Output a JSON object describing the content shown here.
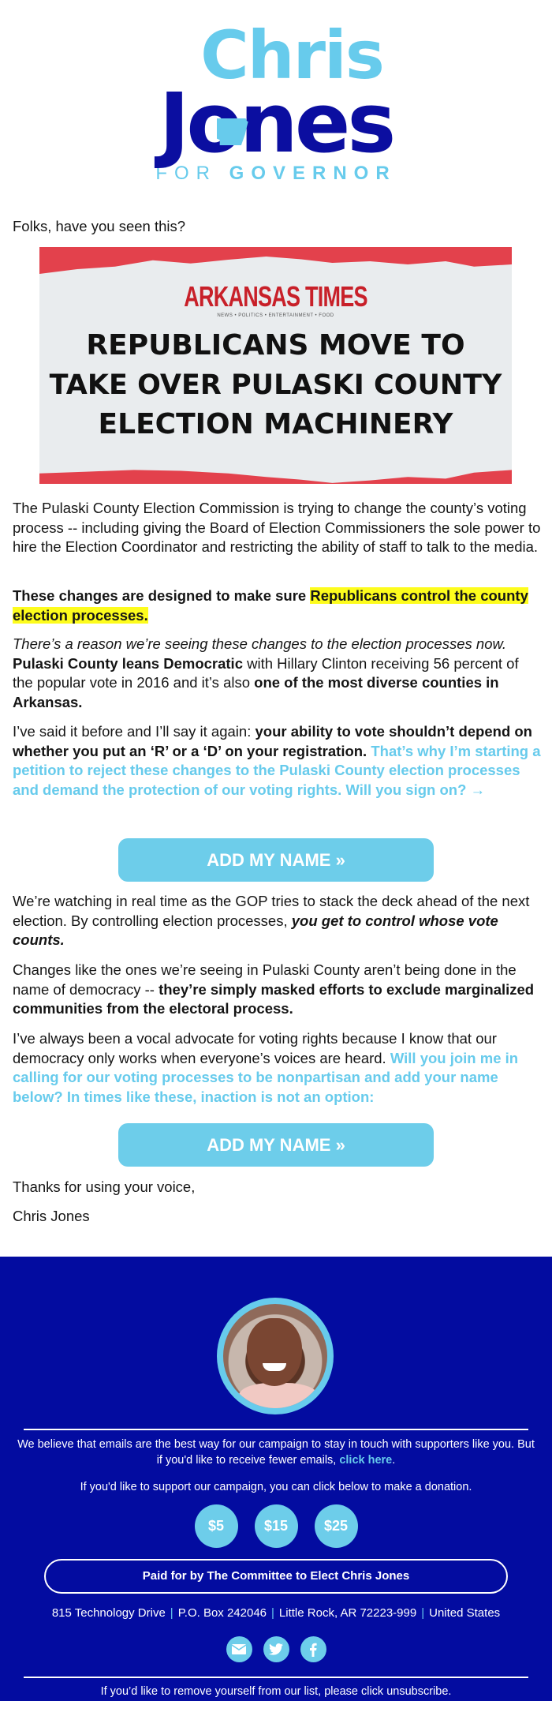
{
  "logo": {
    "first_name": "Chris",
    "last_name": "Jones",
    "subtitle_light": "FOR",
    "subtitle_bold": "GOVERNOR"
  },
  "body": {
    "greeting": "Folks, have you seen this?",
    "hero": {
      "masthead": "ARKANSAS TIMES",
      "tagline": "NEWS • POLITICS • ENTERTAINMENT • FOOD",
      "headline_line1": "REPUBLICANS MOVE TO",
      "headline_line2": "TAKE OVER PULASKI COUNTY",
      "headline_line3": "ELECTION MACHINERY"
    },
    "p1": "The Pulaski County Election Commission is trying to change the county’s voting process -- including giving the Board of Election Commissioners the sole power to hire the Election Coordinator and restricting the ability of staff to talk to the media.",
    "p2_bold": "These changes are designed to make sure ",
    "p2_highlight": "Republicans control the county election processes.",
    "p3_italic": "There’s a reason we’re seeing these changes to the election processes now.",
    "p3_bold1": "Pulaski County leans Democratic",
    "p3_text": " with Hillary Clinton receiving 56 percent of the popular vote in 2016 and it’s also ",
    "p3_bold2": "one of the most diverse counties in Arkansas.",
    "p4_text": "I’ve said it before and I’ll say it again: ",
    "p4_bold": "your ability to vote shouldn’t depend on whether you put an ‘R’ or a ‘D’ on your registration.",
    "p4_cta": "That’s why I’m starting a petition to reject these changes to the Pulaski County election processes and demand the protection of our voting rights. Will you sign on? →",
    "button1": "ADD MY NAME »",
    "p5_text": "We’re watching in real time as the GOP tries to stack the deck ahead of the next election. By controlling election processes, ",
    "p5_italic": "you get to control whose vote counts.",
    "p6_text": "Changes like the ones we’re seeing in Pulaski County aren’t being done in the name of democracy -- ",
    "p6_bold": "they’re simply masked efforts to exclude marginalized communities from the electoral process.",
    "p7_text": "I’ve always been a vocal advocate for voting rights because I know that our democracy only works when everyone’s voices are heard. ",
    "p7_cta": "Will you join me in calling for our voting processes to be nonpartisan and add your name below? In times like these, inaction is not an option:",
    "button2": "ADD MY NAME »",
    "signoff": "Thanks for using your voice,",
    "signature": "Chris Jones"
  },
  "footer": {
    "emails_text": "We believe that emails are the best way for our campaign to stay in touch with supporters like you. But if you'd like to receive fewer emails, ",
    "emails_link": "click here",
    "emails_end": ".",
    "donate_text": "If you'd like to support our campaign, you can click below to make a donation.",
    "donations": [
      "$5",
      "$15",
      "$25"
    ],
    "paid_for": "Paid for by The Committee to Elect Chris Jones",
    "address": [
      "815 Technology Drive",
      "P.O. Box 242046",
      "Little Rock, AR 72223-999",
      "United States"
    ],
    "social": [
      "email-icon",
      "twitter-icon",
      "facebook-icon"
    ],
    "unsubscribe": "If you’d like to remove yourself from our list, please click unsubscribe."
  },
  "colors": {
    "navy": "#030ca0",
    "sky": "#67cbec",
    "highlight": "#fdfc1d",
    "news_red": "#e3414c"
  }
}
